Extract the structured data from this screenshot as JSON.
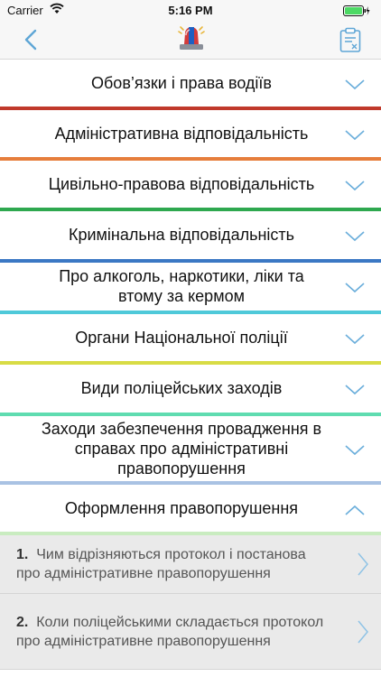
{
  "status": {
    "carrier": "Carrier",
    "time": "5:16 PM"
  },
  "nav": {
    "back_icon": "chevron-left-icon",
    "center_icon": "police-siren-icon",
    "right_icon": "clipboard-icon",
    "tint": "#5fa6d6"
  },
  "sections": [
    {
      "label": "Обов’язки і права водіїв",
      "color": "#c0392b",
      "state": "collapsed"
    },
    {
      "label": "Адміністративна відповідальність",
      "color": "#e67e3c",
      "state": "collapsed"
    },
    {
      "label": "Цивільно-правова відповідальність",
      "color": "#2ea84f",
      "state": "collapsed"
    },
    {
      "label": "Кримінальна відповідальність",
      "color": "#3b78c4",
      "state": "collapsed"
    },
    {
      "label": "Про алкоголь, наркотики, ліки та втому за кермом",
      "color": "#4fc9d9",
      "state": "collapsed"
    },
    {
      "label": "Органи Національної поліції",
      "color": "#d8dc45",
      "state": "collapsed"
    },
    {
      "label": "Види поліцейських заходів",
      "color": "#5fdcb0",
      "state": "collapsed"
    },
    {
      "label": "Заходи забезпечення провадження в справах про адміністративні правопорушення",
      "color": "#a9c2e3",
      "state": "collapsed"
    },
    {
      "label": "Оформлення правопорушення",
      "color": "#c9ecc0",
      "state": "expanded"
    }
  ],
  "subitems": [
    {
      "number": "1.",
      "text": "Чим відрізняються протокол і постанова про адміністративне правопорушення"
    },
    {
      "number": "2.",
      "text": "Коли поліцейськими складається протокол про адміністративне правопорушення"
    }
  ]
}
